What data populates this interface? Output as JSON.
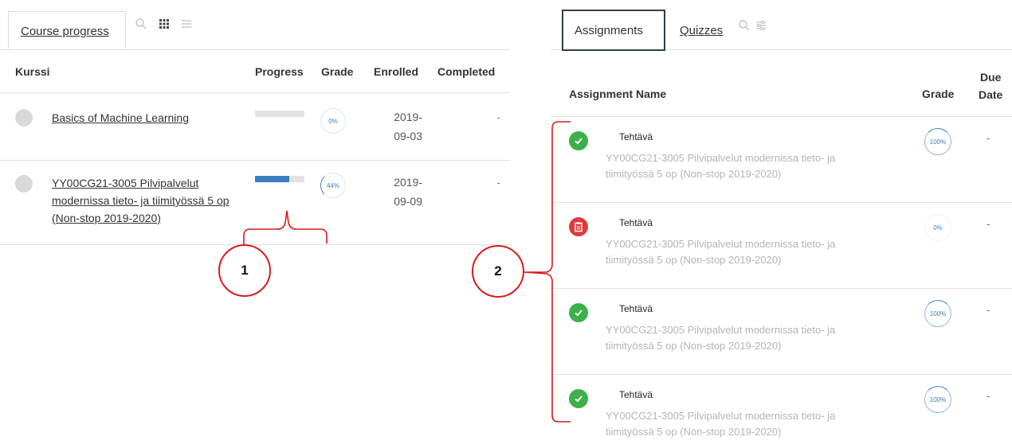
{
  "left": {
    "tab_label": "Course progress",
    "toolbar_icons": [
      "search-icon",
      "grid-view-icon",
      "list-view-icon"
    ],
    "columns": {
      "course": "Kurssi",
      "progress": "Progress",
      "grade": "Grade",
      "enrolled": "Enrolled",
      "completed": "Completed"
    },
    "rows": [
      {
        "name": "Basics of Machine Learning",
        "progress": 0,
        "grade": "0%",
        "enrolled_line1": "2019-",
        "enrolled_line2": "09-03",
        "completed": "-"
      },
      {
        "name": "YY00CG21-3005 Pilvipalvelut modernissa tieto- ja tiimityössä 5 op (Non-stop 2019-2020)",
        "progress": 0.7,
        "grade": "44%",
        "enrolled_line1": "2019-",
        "enrolled_line2": "09-09",
        "completed": "-"
      }
    ]
  },
  "right": {
    "tabs": {
      "assignments": "Assignments",
      "quizzes": "Quizzes"
    },
    "toolbar_icons": [
      "search-icon",
      "filter-icon"
    ],
    "columns": {
      "name": "Assignment Name",
      "grade": "Grade",
      "due_line1": "Due",
      "due_line2": "Date"
    },
    "rows": [
      {
        "title": "Tehtävä",
        "course": "YY00CG21-3005 Pilvipalvelut modernissa tieto- ja tiimityössä 5 op (Non-stop 2019-2020)",
        "grade": "100%",
        "due": "-",
        "status": "completed"
      },
      {
        "title": "Tehtävä",
        "course": "YY00CG21-3005 Pilvipalvelut modernissa tieto- ja tiimityössä 5 op (Non-stop 2019-2020)",
        "grade": "0%",
        "due": "-",
        "status": "not-completed"
      },
      {
        "title": "Tehtävä",
        "course": "YY00CG21-3005 Pilvipalvelut modernissa tieto- ja tiimityössä 5 op (Non-stop 2019-2020)",
        "grade": "100%",
        "due": "-",
        "status": "completed"
      },
      {
        "title": "Tehtävä",
        "course": "YY00CG21-3005 Pilvipalvelut modernissa tieto- ja tiimityössä 5 op (Non-stop 2019-2020)",
        "grade": "100%",
        "due": "-",
        "status": "completed"
      }
    ]
  },
  "annotations": {
    "callout_1": "1",
    "callout_2": "2",
    "color": "#d91b1b"
  },
  "colors": {
    "progress_fill": "#3a7fc4",
    "progress_track": "#e3e3e3",
    "status_done": "#3cb04a",
    "status_todo": "#dc3b3b"
  }
}
